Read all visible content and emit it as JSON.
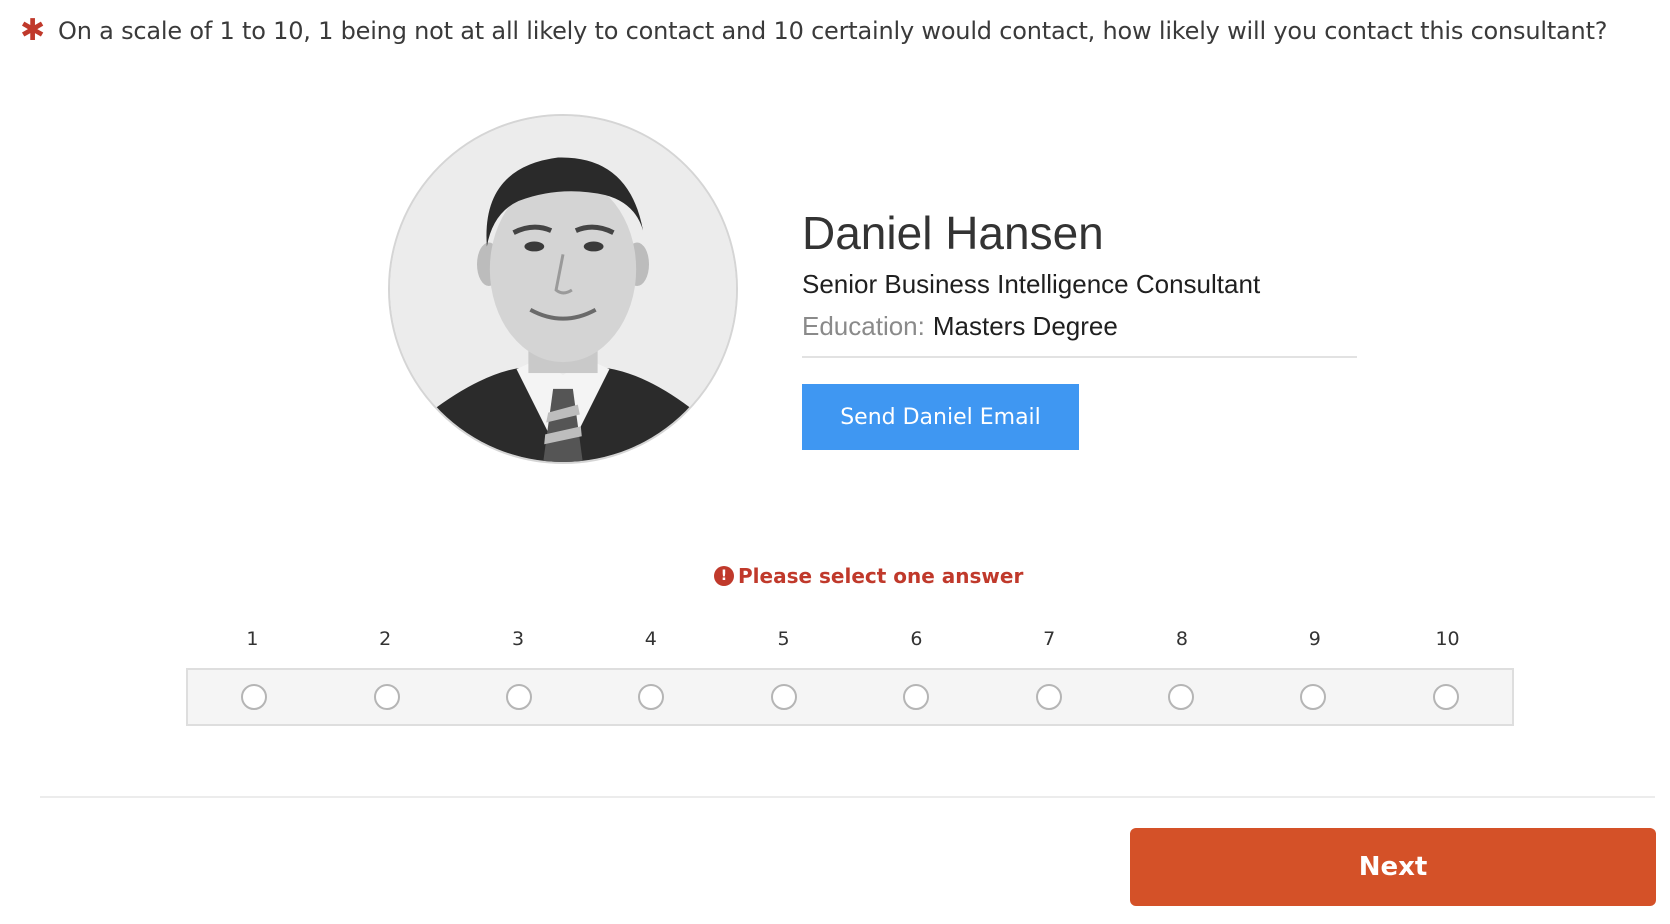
{
  "question": {
    "required_mark": "✱",
    "text": "On a scale of 1 to 10, 1 being not at all likely to contact and 10 certainly would contact, how likely will you contact this consultant?"
  },
  "consultant": {
    "name": "Daniel Hansen",
    "title": "Senior Business Intelligence Consultant",
    "education_label": "Education:",
    "education_value": "Masters Degree",
    "email_button": "Send Daniel Email"
  },
  "validation": {
    "icon": "!",
    "message": "Please select one answer"
  },
  "scale": {
    "labels": [
      "1",
      "2",
      "3",
      "4",
      "5",
      "6",
      "7",
      "8",
      "9",
      "10"
    ],
    "selected": null
  },
  "footer": {
    "next_label": "Next"
  },
  "colors": {
    "accent_blue": "#3f97f2",
    "next_orange": "#d45128",
    "error_red": "#c0392b"
  }
}
